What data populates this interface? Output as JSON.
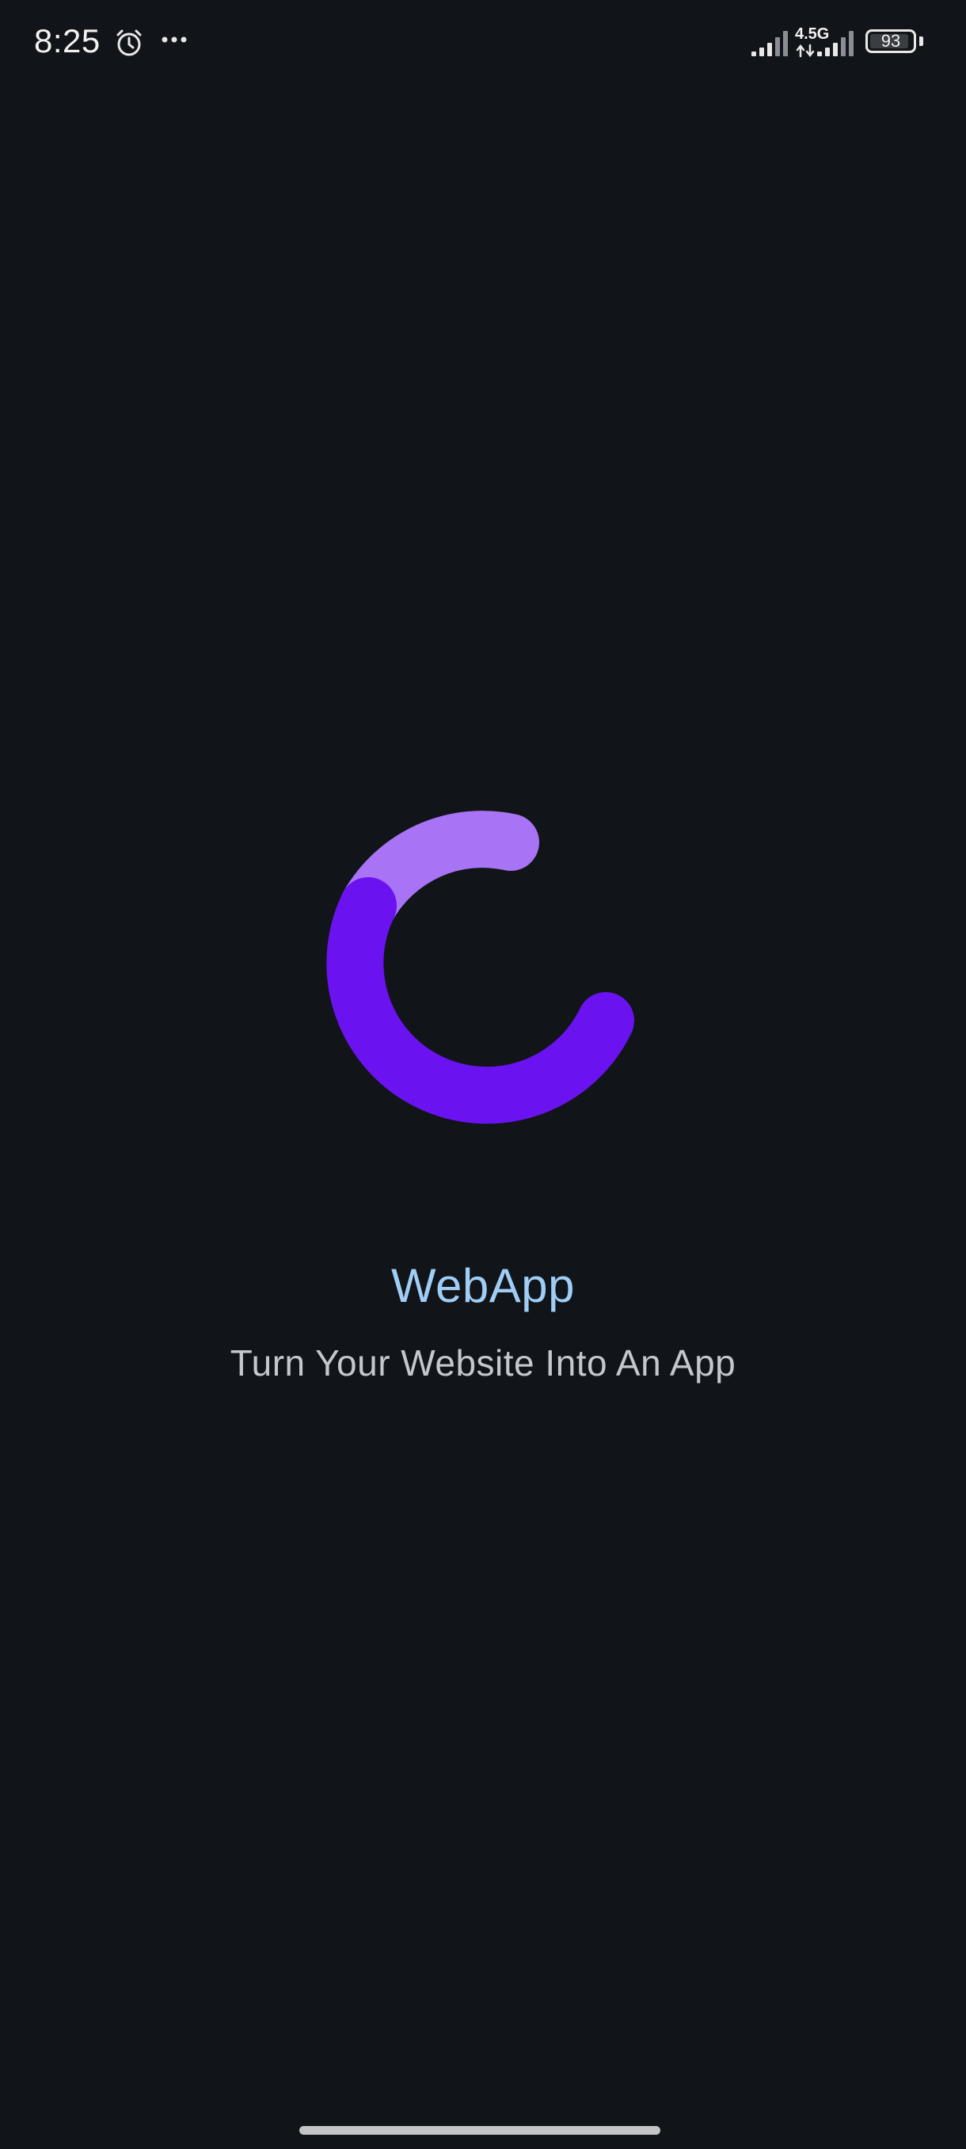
{
  "status_bar": {
    "time": "8:25",
    "alarm_icon": "alarm-clock-icon",
    "more_icon": "more-dots-icon",
    "network_type": "4.5G",
    "battery_level": "93",
    "battery_fraction": 0.93
  },
  "splash": {
    "logo_icon": "loading-arc-logo-icon",
    "app_name": "WebApp",
    "tagline": "Turn Your Website Into An App",
    "colors": {
      "background": "#111418",
      "arc_light": "#a874f5",
      "arc_dark": "#6a13f0",
      "title": "#9fcdf5",
      "tagline": "#c3c8d0"
    }
  }
}
